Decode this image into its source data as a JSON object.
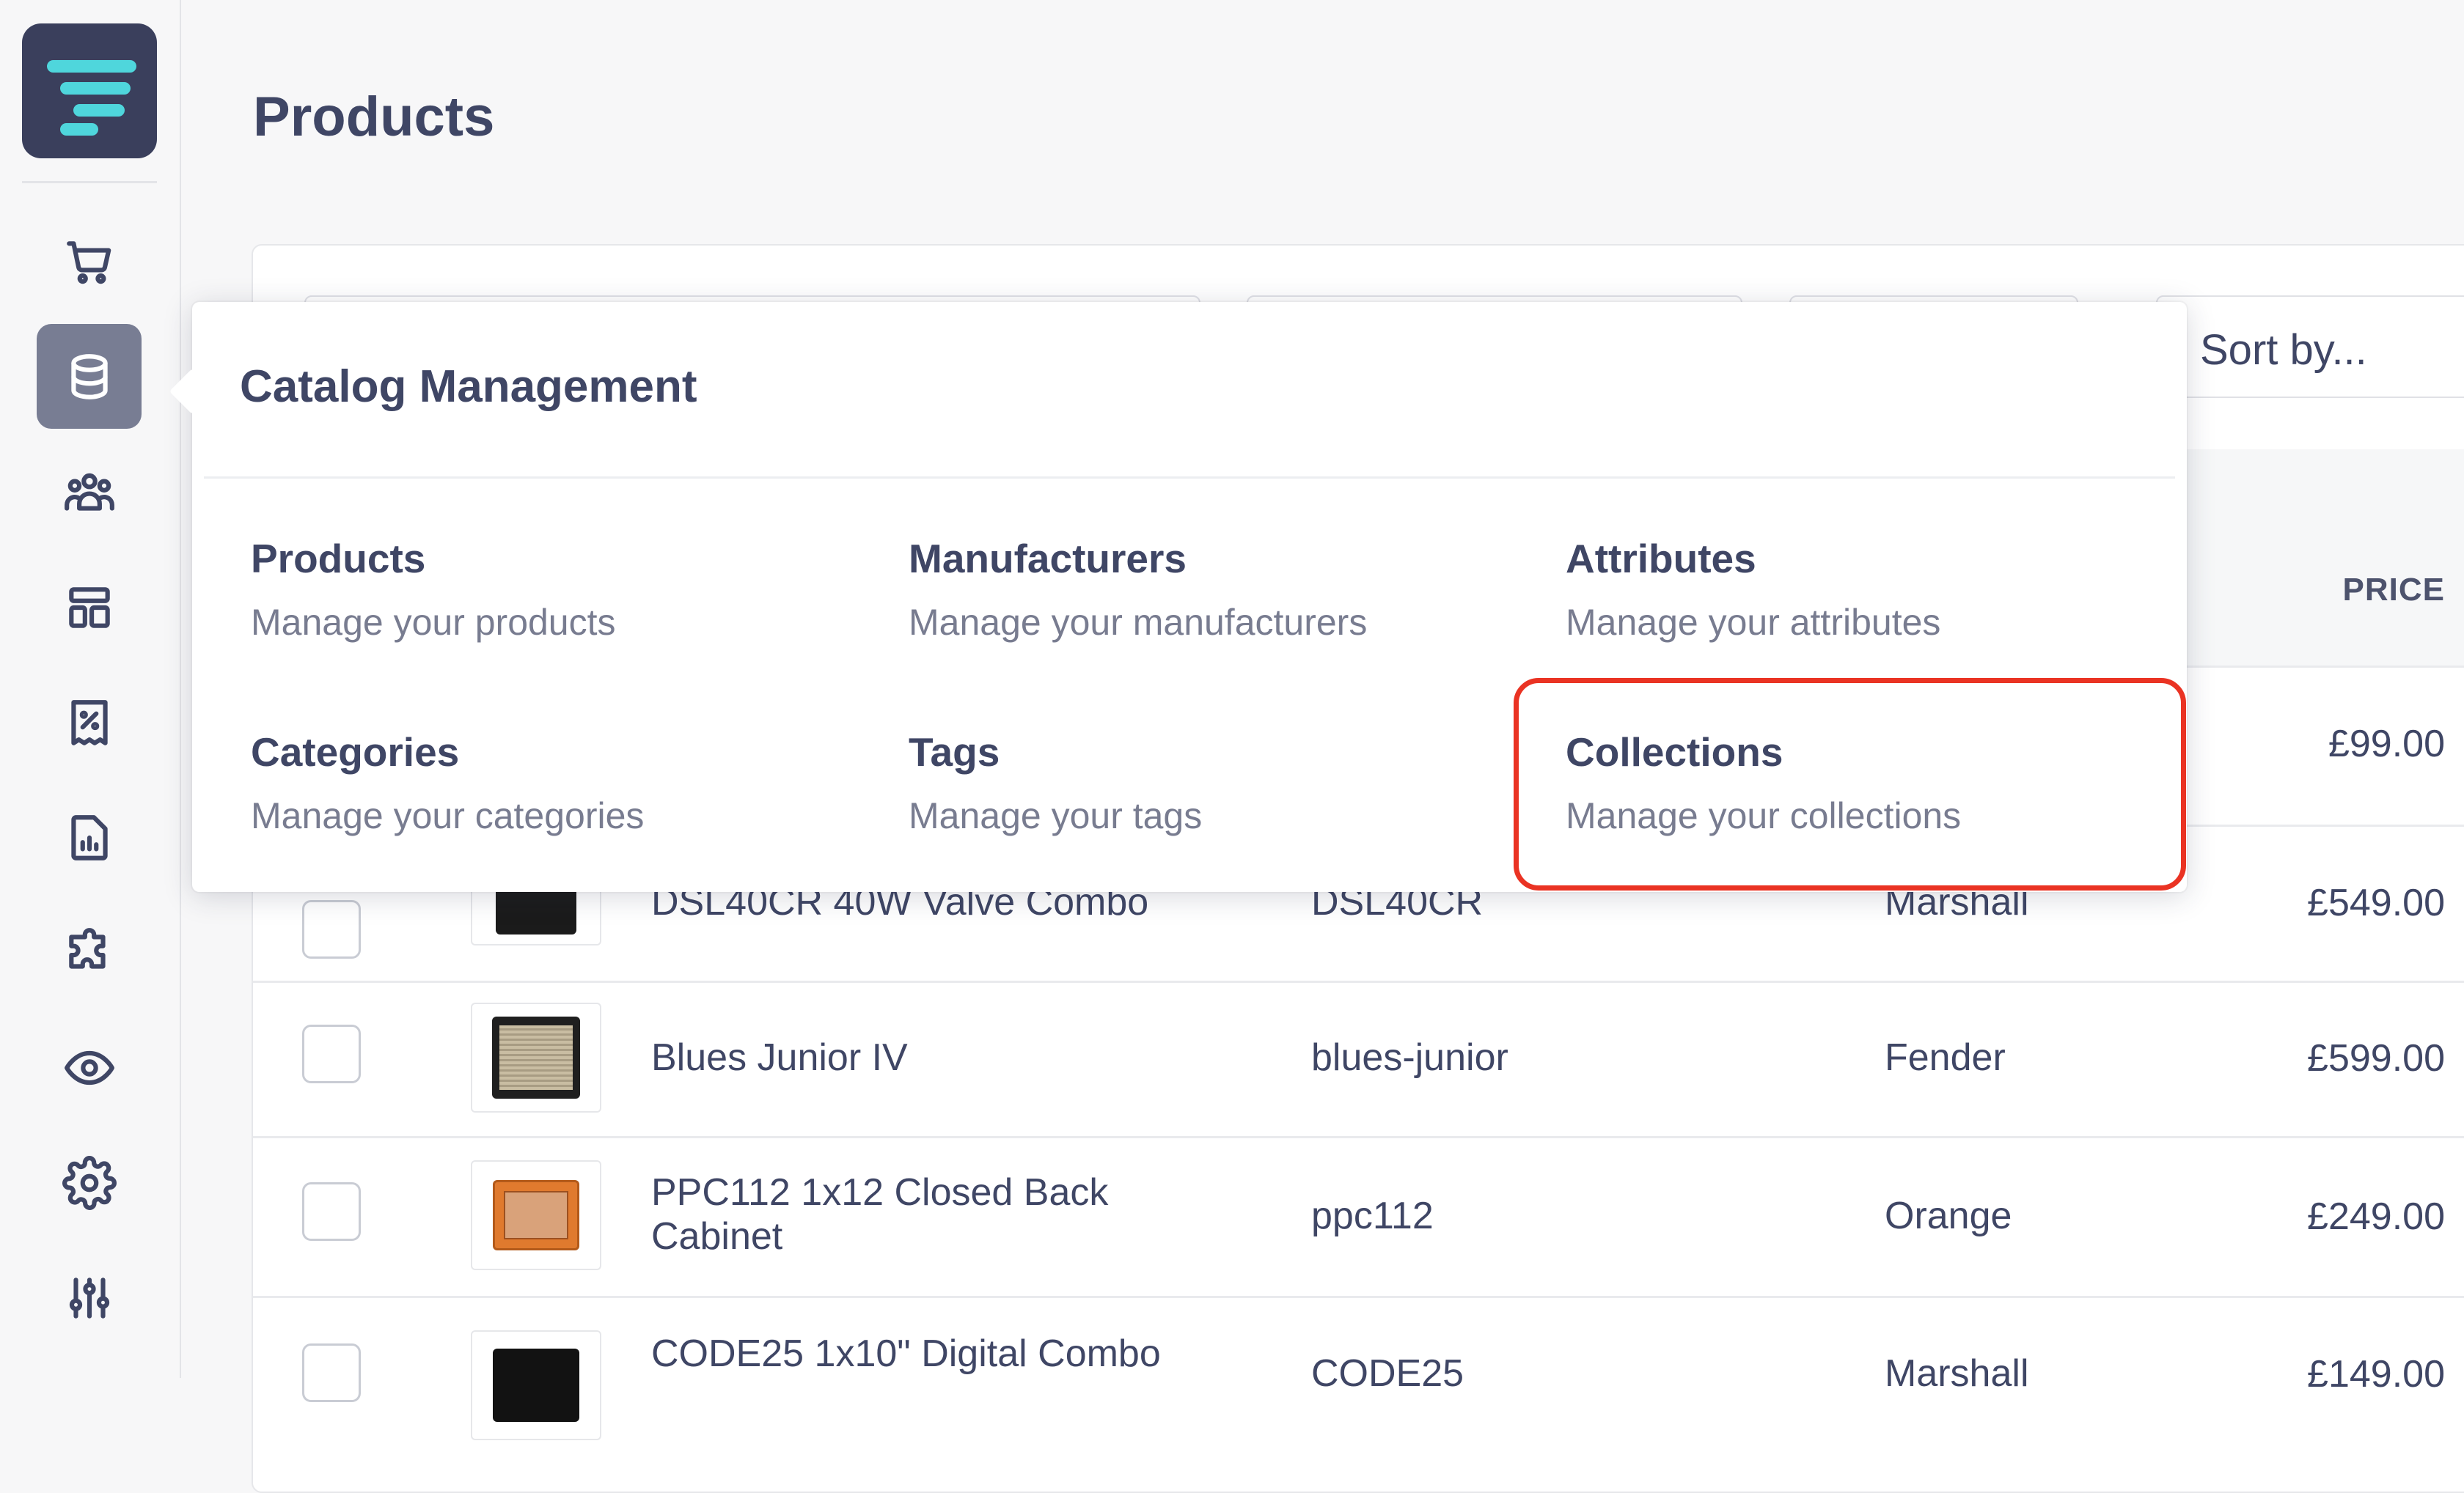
{
  "page": {
    "title": "Products"
  },
  "sidebar": {
    "logo": "filter-stack-logo",
    "items": [
      {
        "name": "orders",
        "icon": "cart-icon"
      },
      {
        "name": "catalog",
        "icon": "database-icon",
        "active": true
      },
      {
        "name": "customers",
        "icon": "users-icon"
      },
      {
        "name": "layout",
        "icon": "layout-icon"
      },
      {
        "name": "promotions",
        "icon": "discount-receipt-icon"
      },
      {
        "name": "reports",
        "icon": "report-chart-icon"
      },
      {
        "name": "extensions",
        "icon": "puzzle-icon"
      },
      {
        "name": "storefront",
        "icon": "eye-icon"
      },
      {
        "name": "settings",
        "icon": "gear-icon"
      },
      {
        "name": "preferences",
        "icon": "sliders-icon"
      }
    ]
  },
  "toolbar": {
    "sort_label": "Sort by..."
  },
  "table": {
    "price_header": "PRICE",
    "rows": [
      {
        "name": "",
        "slug": "",
        "manufacturer": "",
        "price": "£99.00"
      },
      {
        "name": "DSL40CR 40W Valve Combo",
        "slug": "DSL40CR",
        "manufacturer": "Marshall",
        "price": "£549.00"
      },
      {
        "name": "Blues Junior IV",
        "slug": "blues-junior",
        "manufacturer": "Fender",
        "price": "£599.00"
      },
      {
        "name": "PPC112 1x12 Closed Back",
        "name_line2": "Cabinet",
        "slug": "ppc112",
        "manufacturer": "Orange",
        "price": "£249.00"
      },
      {
        "name": "CODE25 1x10\" Digital Combo",
        "slug": "CODE25",
        "manufacturer": "Marshall",
        "price": "£149.00"
      }
    ]
  },
  "popover": {
    "title": "Catalog Management",
    "items": [
      {
        "title": "Products",
        "description": "Manage your products"
      },
      {
        "title": "Manufacturers",
        "description": "Manage your manufacturers"
      },
      {
        "title": "Attributes",
        "description": "Manage your attributes"
      },
      {
        "title": "Categories",
        "description": "Manage your categories"
      },
      {
        "title": "Tags",
        "description": "Manage your tags"
      },
      {
        "title": "Collections",
        "description": "Manage your collections",
        "highlighted": true
      }
    ]
  },
  "colors": {
    "text": "#3f4665",
    "muted": "#787c90",
    "active_nav": "#787d93",
    "logo_bg": "#3a3f5c",
    "logo_accent": "#4fd6dc",
    "highlight": "#ea3323"
  }
}
